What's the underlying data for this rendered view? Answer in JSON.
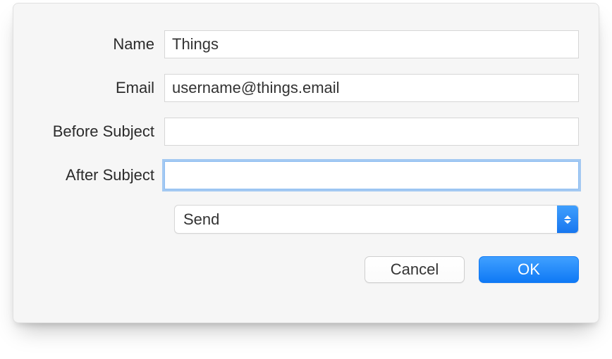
{
  "form": {
    "nameLabel": "Name",
    "nameValue": "Things",
    "emailLabel": "Email",
    "emailValue": "username@things.email",
    "beforeSubjectLabel": "Before Subject",
    "beforeSubjectValue": "",
    "afterSubjectLabel": "After Subject",
    "afterSubjectValue": "",
    "actionSelected": "Send"
  },
  "buttons": {
    "cancel": "Cancel",
    "ok": "OK"
  }
}
